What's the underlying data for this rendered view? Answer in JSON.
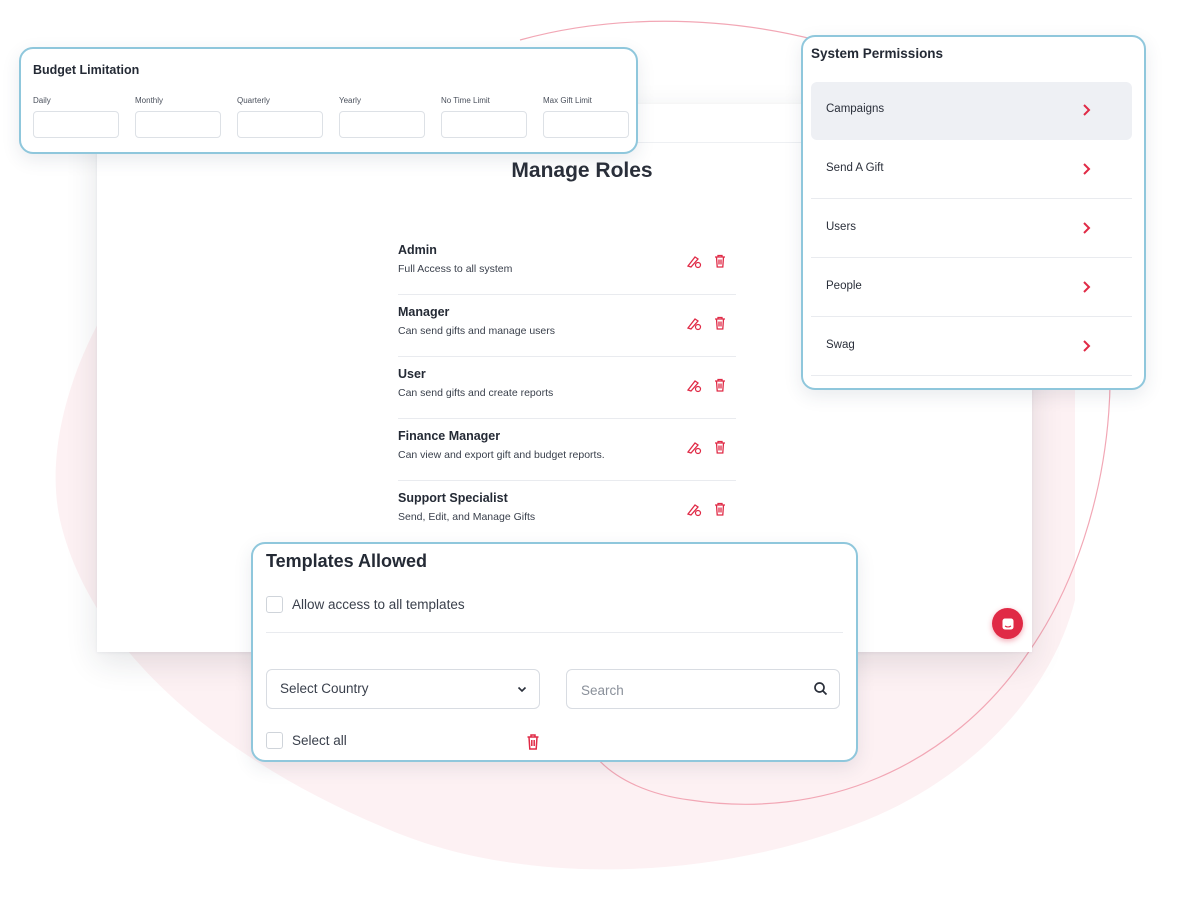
{
  "budget": {
    "title": "Budget Limitation",
    "fields": [
      {
        "label": "Daily",
        "value": ""
      },
      {
        "label": "Monthly",
        "value": ""
      },
      {
        "label": "Quarterly",
        "value": ""
      },
      {
        "label": "Yearly",
        "value": ""
      },
      {
        "label": "No Time Limit",
        "value": ""
      },
      {
        "label": "Max Gift Limit",
        "value": ""
      }
    ]
  },
  "main": {
    "title": "Manage Roles",
    "roles": [
      {
        "name": "Admin",
        "description": "Full Access to all system"
      },
      {
        "name": "Manager",
        "description": "Can send gifts and manage users"
      },
      {
        "name": "User",
        "description": "Can send gifts and create reports"
      },
      {
        "name": "Finance Manager",
        "description": "Can view and export gift and budget reports."
      },
      {
        "name": "Support Specialist",
        "description": "Send, Edit, and Manage Gifts"
      }
    ],
    "role_action_icons": [
      "edit-icon",
      "trash-icon"
    ]
  },
  "permissions": {
    "title": "System Permissions",
    "items": [
      {
        "label": "Campaigns",
        "active": true
      },
      {
        "label": "Send A Gift",
        "active": false
      },
      {
        "label": "Users",
        "active": false
      },
      {
        "label": "People",
        "active": false
      },
      {
        "label": "Swag",
        "active": false
      }
    ]
  },
  "templates": {
    "title": "Templates Allowed",
    "allow_all_label": "Allow access to all templates",
    "country_select": {
      "value": "Select Country"
    },
    "search": {
      "placeholder": "Search",
      "value": ""
    },
    "select_all_label": "Select all"
  },
  "colors": {
    "accent": "#e02a46",
    "panel_border": "#8fc7dc",
    "active_row": "#eef0f4"
  }
}
